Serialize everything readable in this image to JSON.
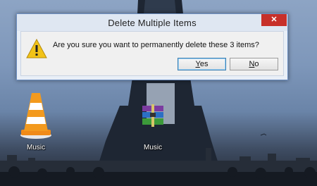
{
  "dialog": {
    "title": "Delete Multiple Items",
    "close_glyph": "✕",
    "message": "Are you sure you want to permanently delete these 3 items?",
    "yes_accel": "Y",
    "yes_rest": "es",
    "no_accel": "N",
    "no_rest": "o",
    "icon": "warning-icon"
  },
  "desktop": {
    "icons": [
      {
        "label": "Music",
        "icon": "vlc-cone-icon"
      },
      {
        "label": "Music",
        "icon": "winrar-books-icon"
      }
    ]
  },
  "colors": {
    "close_button": "#c7302a",
    "dialog_border": "#6d8fc2",
    "sky": "#7e97ba"
  }
}
